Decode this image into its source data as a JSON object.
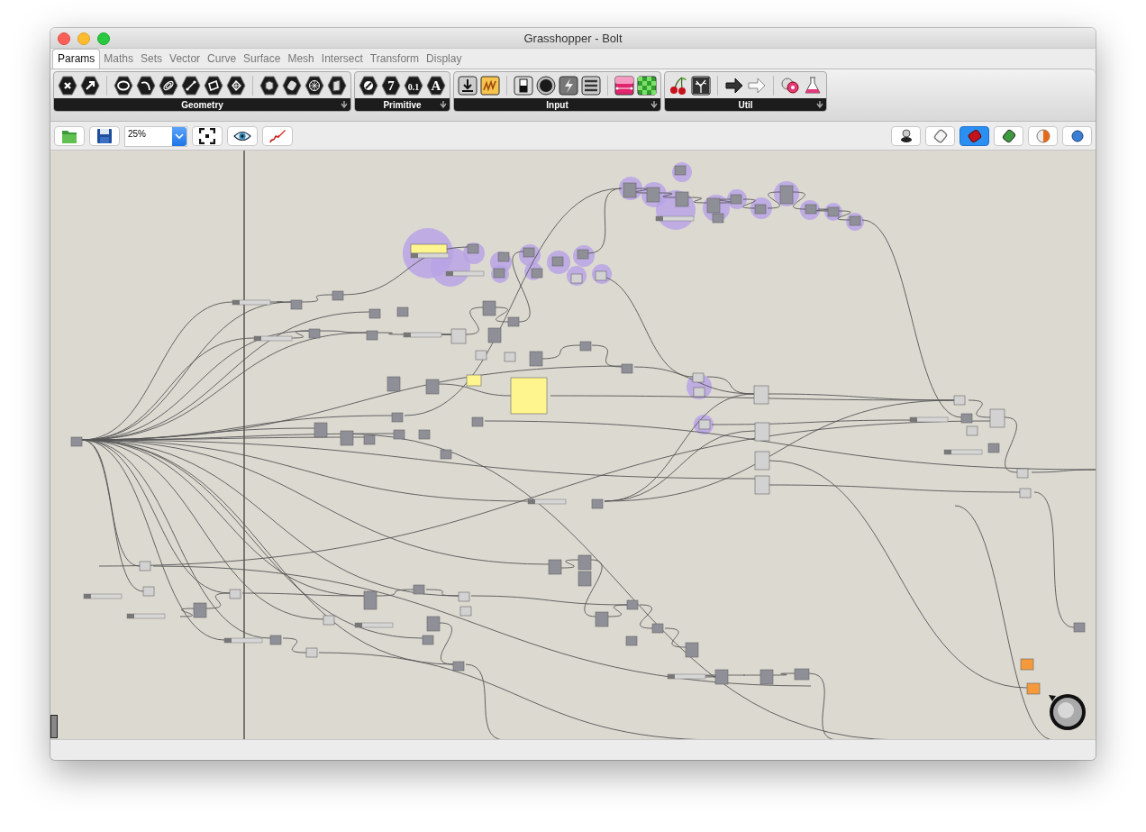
{
  "window": {
    "title": "Grasshopper - Bolt"
  },
  "tabs": [
    {
      "label": "Params",
      "selected": true
    },
    {
      "label": "Maths",
      "selected": false
    },
    {
      "label": "Sets",
      "selected": false
    },
    {
      "label": "Vector",
      "selected": false
    },
    {
      "label": "Curve",
      "selected": false
    },
    {
      "label": "Surface",
      "selected": false
    },
    {
      "label": "Mesh",
      "selected": false
    },
    {
      "label": "Intersect",
      "selected": false
    },
    {
      "label": "Transform",
      "selected": false
    },
    {
      "label": "Display",
      "selected": false
    }
  ],
  "ribbon": [
    {
      "label": "Geometry",
      "sections": [
        [
          {
            "kind": "hex-cross"
          },
          {
            "kind": "hex-arrow"
          }
        ],
        [
          {
            "kind": "hex-circle"
          },
          {
            "kind": "hex-curve"
          },
          {
            "kind": "hex-spiral"
          },
          {
            "kind": "hex-line"
          },
          {
            "kind": "hex-surface"
          },
          {
            "kind": "hex-frame"
          }
        ],
        [
          {
            "kind": "hex-box"
          },
          {
            "kind": "hex-cylinder"
          },
          {
            "kind": "hex-mesh"
          },
          {
            "kind": "hex-sheet"
          }
        ]
      ]
    },
    {
      "label": "Primitive",
      "sections": [
        [
          {
            "kind": "hex-disc"
          },
          {
            "kind": "hex-glyph",
            "glyph": "7"
          },
          {
            "kind": "hex-glyph",
            "glyph": "0.1"
          },
          {
            "kind": "hex-glyph",
            "glyph": "A"
          }
        ]
      ]
    },
    {
      "label": "Input",
      "sections": [
        [
          {
            "kind": "tile-download"
          },
          {
            "kind": "tile-graph"
          }
        ],
        [
          {
            "kind": "tile-toggle"
          },
          {
            "kind": "tile-knob"
          },
          {
            "kind": "tile-bolt"
          },
          {
            "kind": "tile-list"
          }
        ],
        [
          {
            "kind": "tile-gradient"
          },
          {
            "kind": "tile-swatch"
          }
        ]
      ]
    },
    {
      "label": "Util",
      "sections": [
        [
          {
            "kind": "cherry"
          },
          {
            "kind": "tree"
          }
        ],
        [
          {
            "kind": "arrow-solid"
          },
          {
            "kind": "arrow-outline"
          }
        ],
        [
          {
            "kind": "discs"
          },
          {
            "kind": "flask"
          }
        ]
      ]
    }
  ],
  "toolbar": {
    "zoom": "25%"
  }
}
